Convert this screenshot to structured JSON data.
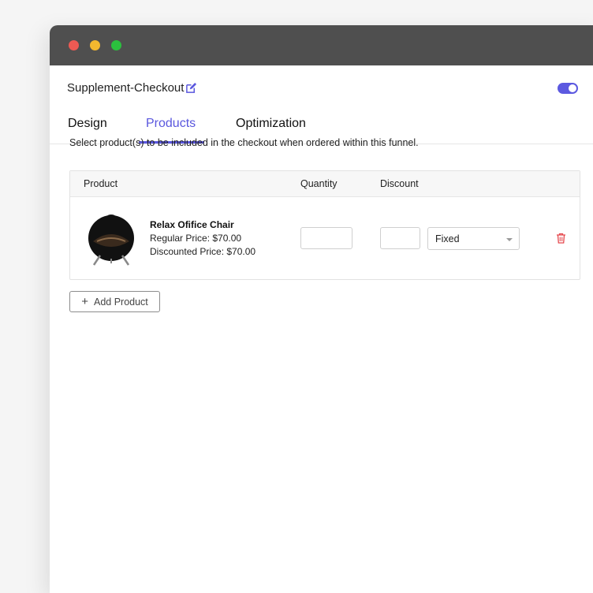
{
  "header": {
    "title": "Supplement-Checkout",
    "edit_icon": "edit-icon",
    "toggle_on": true,
    "accent_color": "#5a57de"
  },
  "tabs": [
    {
      "label": "Design",
      "active": false
    },
    {
      "label": "Products",
      "active": true
    },
    {
      "label": "Optimization",
      "active": false
    }
  ],
  "intro_text": "Select product(s) to be included in the checkout when ordered within this funnel.",
  "table": {
    "headers": {
      "product": "Product",
      "quantity": "Quantity",
      "discount": "Discount"
    },
    "rows": [
      {
        "name": "Relax Ofifice Chair",
        "regular_price": "Regular Price: $70.00",
        "discounted_price": "Discounted Price: $70.00",
        "quantity": "",
        "discount": "",
        "discount_type": "Fixed"
      }
    ]
  },
  "add_product_label": "Add Product",
  "colors": {
    "delete": "#e5484d",
    "titlebar": "#4f4f4f"
  }
}
